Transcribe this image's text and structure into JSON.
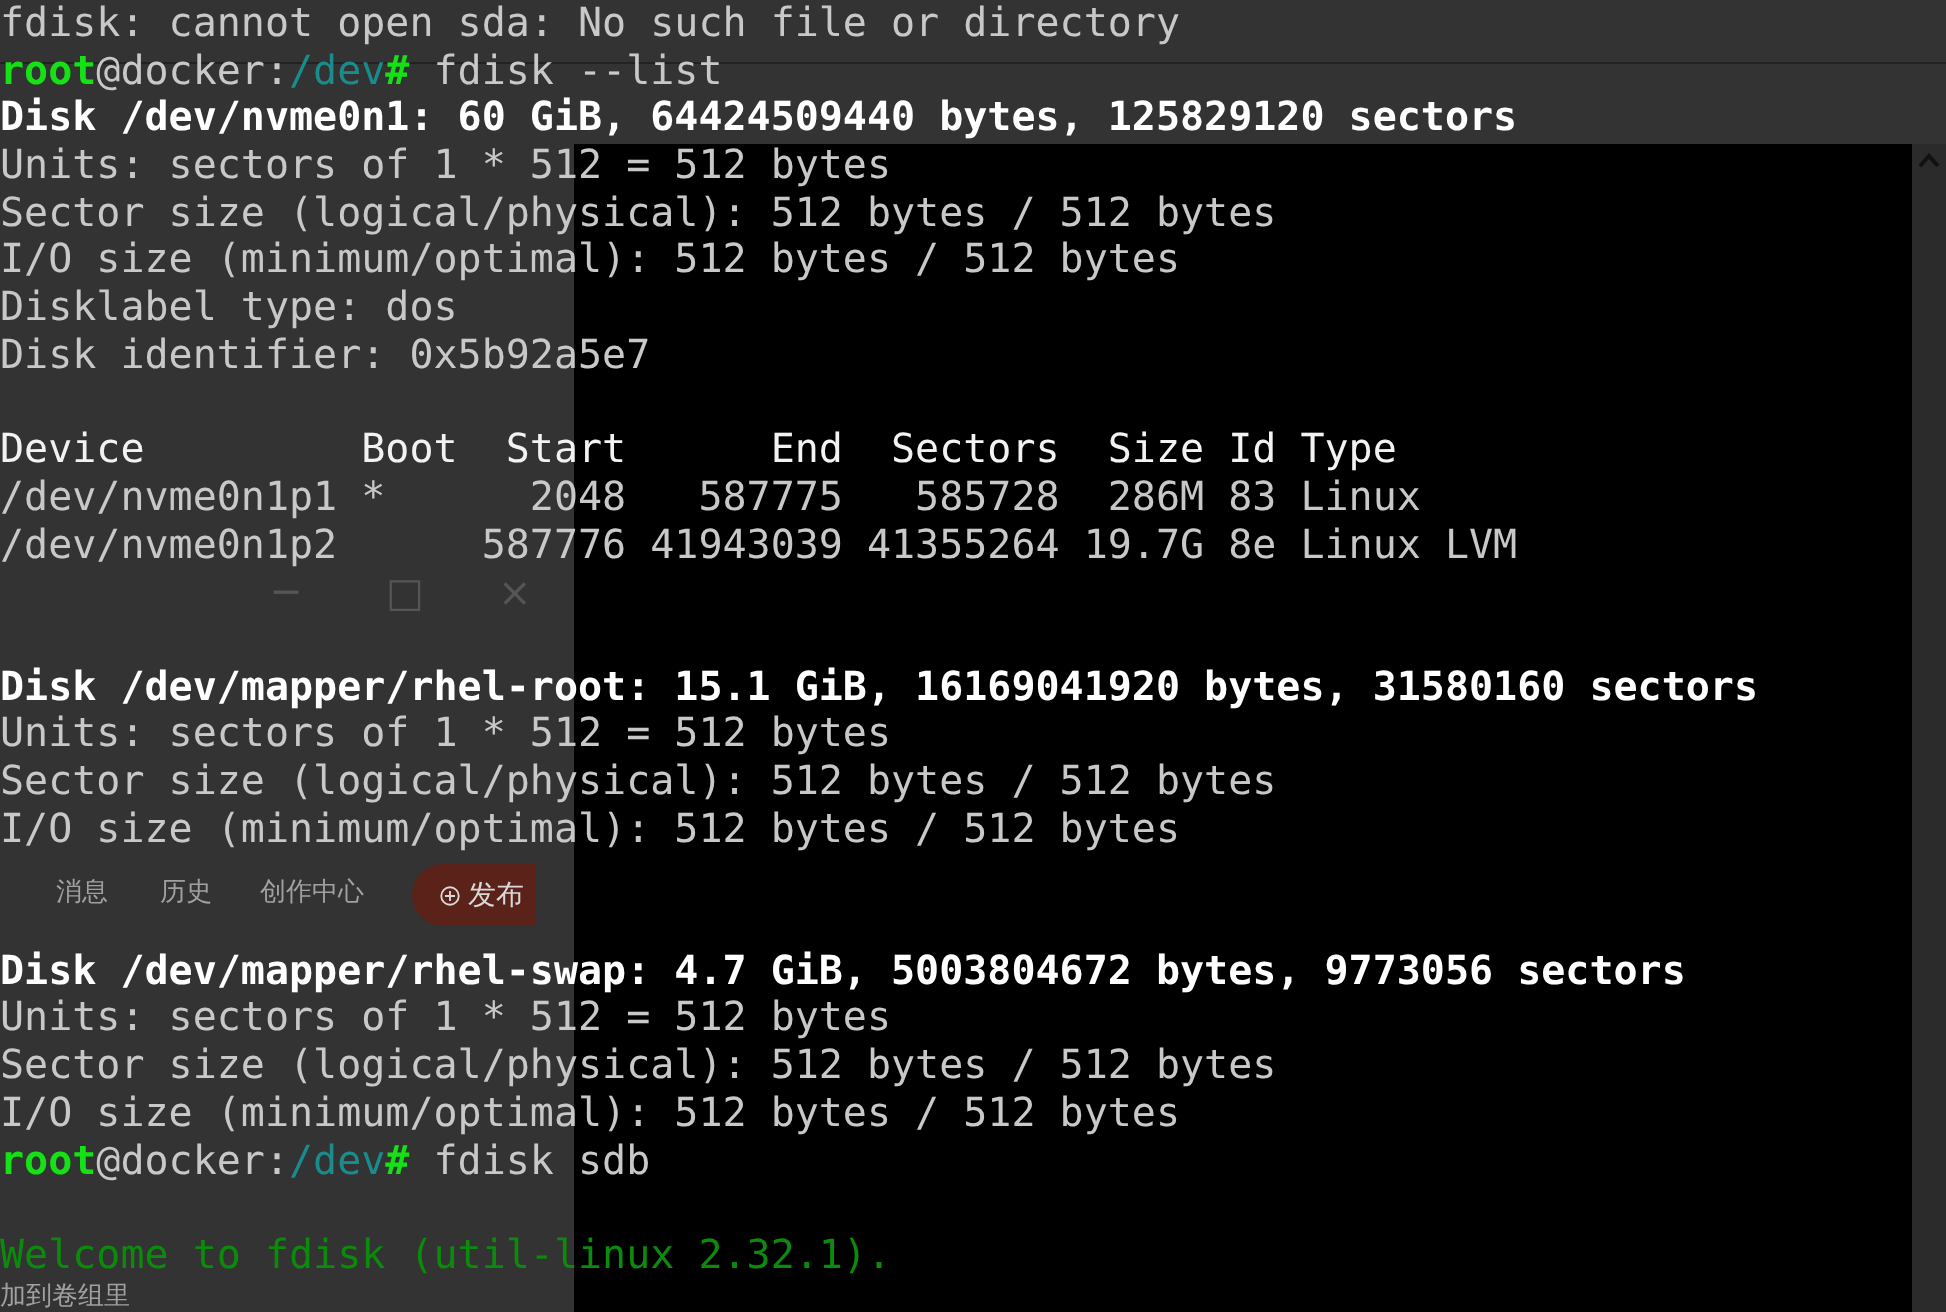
{
  "terminal": {
    "lines": [
      {
        "kind": "text",
        "text": "fdisk: cannot open sda: No such file or directory"
      },
      {
        "kind": "prompt",
        "user": "root",
        "host": "@docker:",
        "path": "/dev",
        "symbol": "#",
        "command": " fdisk --list"
      },
      {
        "kind": "bold",
        "text": "Disk /dev/nvme0n1: 60 GiB, 64424509440 bytes, 125829120 sectors"
      },
      {
        "kind": "text",
        "text": "Units: sectors of 1 * 512 = 512 bytes"
      },
      {
        "kind": "text",
        "text": "Sector size (logical/physical): 512 bytes / 512 bytes"
      },
      {
        "kind": "text",
        "text": "I/O size (minimum/optimal): 512 bytes / 512 bytes"
      },
      {
        "kind": "text",
        "text": "Disklabel type: dos"
      },
      {
        "kind": "text",
        "text": "Disk identifier: 0x5b92a5e7"
      },
      {
        "kind": "blank"
      },
      {
        "kind": "header",
        "text": "Device         Boot  Start      End  Sectors  Size Id Type"
      },
      {
        "kind": "text",
        "text": "/dev/nvme0n1p1 *      2048   587775   585728  286M 83 Linux"
      },
      {
        "kind": "text",
        "text": "/dev/nvme0n1p2      587776 41943039 41355264 19.7G 8e Linux LVM"
      },
      {
        "kind": "blank"
      },
      {
        "kind": "blank"
      },
      {
        "kind": "bold",
        "text": "Disk /dev/mapper/rhel-root: 15.1 GiB, 16169041920 bytes, 31580160 sectors"
      },
      {
        "kind": "text",
        "text": "Units: sectors of 1 * 512 = 512 bytes"
      },
      {
        "kind": "text",
        "text": "Sector size (logical/physical): 512 bytes / 512 bytes"
      },
      {
        "kind": "text",
        "text": "I/O size (minimum/optimal): 512 bytes / 512 bytes"
      },
      {
        "kind": "blank"
      },
      {
        "kind": "blank"
      },
      {
        "kind": "bold",
        "text": "Disk /dev/mapper/rhel-swap: 4.7 GiB, 5003804672 bytes, 9773056 sectors"
      },
      {
        "kind": "text",
        "text": "Units: sectors of 1 * 512 = 512 bytes"
      },
      {
        "kind": "text",
        "text": "Sector size (logical/physical): 512 bytes / 512 bytes"
      },
      {
        "kind": "text",
        "text": "I/O size (minimum/optimal): 512 bytes / 512 bytes"
      },
      {
        "kind": "prompt",
        "user": "root",
        "host": "@docker:",
        "path": "/dev",
        "symbol": "#",
        "command": " fdisk sdb"
      },
      {
        "kind": "blank"
      },
      {
        "kind": "welcome",
        "text": "Welcome to fdisk (util-linux 2.32.1)."
      }
    ]
  },
  "background_window": {
    "controls": [
      "─",
      "□",
      "×"
    ],
    "tabs": [
      {
        "label": "消息"
      },
      {
        "label": "历史"
      },
      {
        "label": "创作中心"
      }
    ],
    "publish_button": {
      "label": "发布"
    },
    "footer_text": "加到卷组里"
  }
}
